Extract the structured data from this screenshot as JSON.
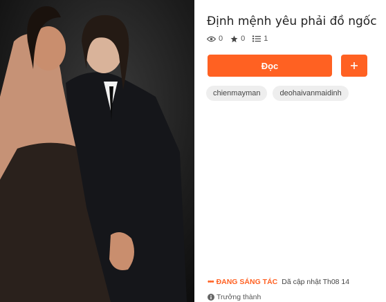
{
  "story": {
    "title": "Định mệnh yêu phải đồ ngốc",
    "reads": "0",
    "votes": "0",
    "parts": "1"
  },
  "actions": {
    "read_label": "Đọc",
    "add_label": "+"
  },
  "tags": [
    "chienmayman",
    "deohaivanmaidinh"
  ],
  "status": {
    "dots": "•••",
    "label": "ĐANG SÁNG TÁC",
    "updated": "Dã cập nhật Th08 14",
    "rating": "Trưởng thành"
  },
  "colors": {
    "accent": "#ff6122",
    "tag_bg": "#eeeeee"
  },
  "icons": {
    "reads": "eye-icon",
    "votes": "star-icon",
    "parts": "list-icon",
    "add": "plus-icon",
    "rating": "info-icon"
  }
}
